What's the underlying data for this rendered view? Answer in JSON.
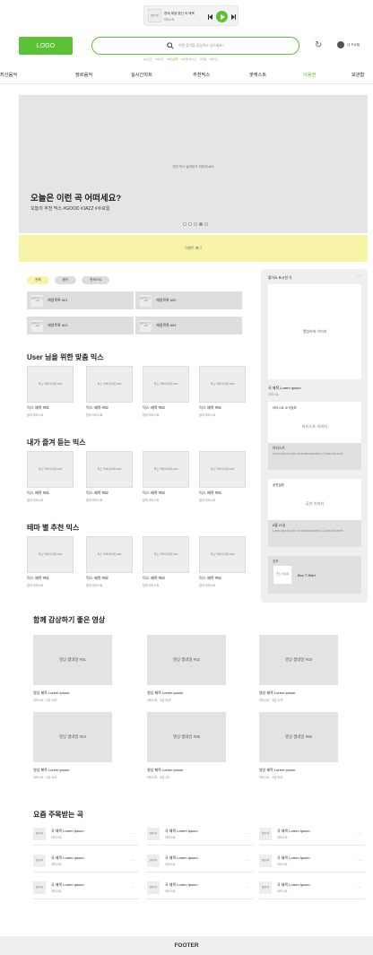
{
  "player": {
    "thumb": "앨범커버",
    "title": "현재 재생 중인 곡 제목",
    "artist": "아티스트"
  },
  "header": {
    "logo": "LOGO",
    "search_placeholder": "어떤 음악을 감상하고 싶으세요?",
    "search_chips": [
      "#프로필",
      "#아이돌",
      "#밴드음악",
      "#플레이리스트",
      "#힐링",
      "#발라드"
    ],
    "user_label": "내 프로필"
  },
  "nav": [
    "최신음악",
    "장르음악",
    "실시간차트",
    "추천믹스",
    "팟캐스트",
    "이용권",
    "보관함"
  ],
  "hero": {
    "image_label": "추천 믹스 슬라이드 이미지 #01",
    "title": "오늘은 이런 곡 어떠세요?",
    "subtitle": "오늘의 추천 믹스 #GOOD #JAZZ #수요일"
  },
  "banner": "이벤트 배너",
  "filters": [
    "전체",
    "음악",
    "팟캐스트"
  ],
  "my_playlists": {
    "thumb": "플레이리스트 커버",
    "items": [
      "재생목록 #01",
      "재생목록 #02",
      "재생목록 #03",
      "재생목록 #04"
    ]
  },
  "sections": [
    {
      "title": "User 님을 위한 맞춤 믹스",
      "cards": [
        {
          "img": "믹스 커버 이미지 #01",
          "title": "믹스 제목 #01",
          "sub": "참여 아티스트"
        },
        {
          "img": "믹스 커버 이미지 #02",
          "title": "믹스 제목 #02",
          "sub": "참여 아티스트"
        },
        {
          "img": "믹스 커버 이미지 #03",
          "title": "믹스 제목 #03",
          "sub": "참여 아티스트"
        },
        {
          "img": "믹스 커버 이미지 #04",
          "title": "믹스 제목 #04",
          "sub": "참여 아티스트"
        }
      ]
    },
    {
      "title": "내가 즐겨 듣는 믹스",
      "cards": [
        {
          "img": "믹스 커버 이미지 #01",
          "title": "믹스 제목 #01",
          "sub": "참여 아티스트"
        },
        {
          "img": "믹스 커버 이미지 #02",
          "title": "믹스 제목 #02",
          "sub": "참여 아티스트"
        },
        {
          "img": "믹스 커버 이미지 #03",
          "title": "믹스 제목 #03",
          "sub": "참여 아티스트"
        },
        {
          "img": "믹스 커버 이미지 #04",
          "title": "믹스 제목 #04",
          "sub": "참여 아티스트"
        }
      ]
    },
    {
      "title": "테마 별 추천 믹스",
      "cards": [
        {
          "img": "믹스 커버 이미지 #01",
          "title": "믹스 제목 #01",
          "sub": "참여 아티스트"
        },
        {
          "img": "믹스 커버 이미지 #02",
          "title": "믹스 제목 #02",
          "sub": "참여 아티스트"
        },
        {
          "img": "믹스 커버 이미지 #03",
          "title": "믹스 제목 #03",
          "sub": "참여 아티스트"
        },
        {
          "img": "믹스 커버 이미지 #04",
          "title": "믹스 제목 #04",
          "sub": "참여 아티스트"
        }
      ]
    }
  ],
  "sidebar": {
    "title": "좋아요 표시한 곡",
    "more": "···",
    "album": "앨범커버 이미지",
    "song_title": "곡 제목 Lorem Ipsum",
    "song_artist": "아티스트",
    "artist_box": {
      "label": "아티스트 소식정보",
      "image": "아티스트 이미지",
      "name": "아티스트",
      "desc": "Lorem ipsum dolor sit ametconsectetur. A placerat amet ..."
    },
    "concert_box": {
      "label": "공연일정",
      "image": "공연 이미지",
      "date": "8월 21일",
      "desc": "Lorem ipsum dolor sit ametconsectetur. A placerat amet ..."
    },
    "goods": {
      "label": "굿즈",
      "image": "굿즈 이미지",
      "name": "Box T-Shirt"
    }
  },
  "videos": {
    "title": "함께 감상하기 좋은 영상",
    "items": [
      {
        "img": "영상 썸네일 #01",
        "title": "영상 제목 Lorem Ipsum",
        "meta": "아티스트 · 4분 10초"
      },
      {
        "img": "영상 썸네일 #02",
        "title": "영상 제목 Lorem Ipsum",
        "meta": "아티스트 · 3분 26초"
      },
      {
        "img": "영상 썸네일 #03",
        "title": "영상 제목 Lorem Ipsum",
        "meta": "아티스트 · 3분 47초"
      },
      {
        "img": "영상 썸네일 #04",
        "title": "영상 제목 Lorem Ipsum",
        "meta": "아티스트 · 4분 31초"
      },
      {
        "img": "영상 썸네일 #05",
        "title": "영상 제목 Lorem Ipsum",
        "meta": "아티스트 · 5분 1초"
      },
      {
        "img": "영상 썸네일 #06",
        "title": "영상 제목 Lorem Ipsum",
        "meta": "아티스트 · 2분 53초"
      }
    ]
  },
  "trending": {
    "title": "요즘 주목받는 곡",
    "thumb": "앨범커버",
    "song_title": "곡 제목 Lorem Ipsum",
    "artist": "아티스트",
    "more": "···"
  },
  "footer": "FOOTER"
}
